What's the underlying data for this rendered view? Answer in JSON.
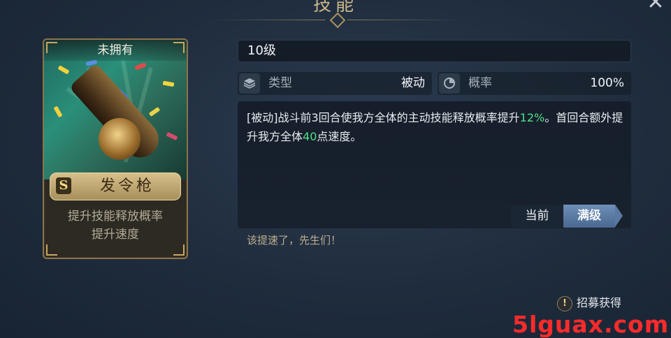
{
  "header": {
    "title": "技能",
    "close_icon": "close-icon"
  },
  "card": {
    "status": "未拥有",
    "rank": "S",
    "name": "发令枪",
    "desc_line1": "提升技能释放概率",
    "desc_line2": "提升速度"
  },
  "level": {
    "text": "10级"
  },
  "type": {
    "icon": "layers-icon",
    "label": "类型",
    "value": "被动"
  },
  "rate": {
    "icon": "dial-icon",
    "label": "概率",
    "value": "100%"
  },
  "description": {
    "part1": "[被动]战斗前3回合使我方全体的主动技能释放概率提升",
    "highlight1": "12%",
    "part2": "。首回合额外提升我方全体",
    "highlight2": "40",
    "part3": "点速度。",
    "highlight_color": "#4fe08a"
  },
  "level_toggle": {
    "current_label": "当前",
    "max_label": "满级",
    "selected": "满级"
  },
  "quote": "该提速了，先生们！",
  "recruit": {
    "icon": "alert-icon",
    "icon_glyph": "!",
    "label": "招募获得"
  },
  "watermark": "5lguax.com"
}
